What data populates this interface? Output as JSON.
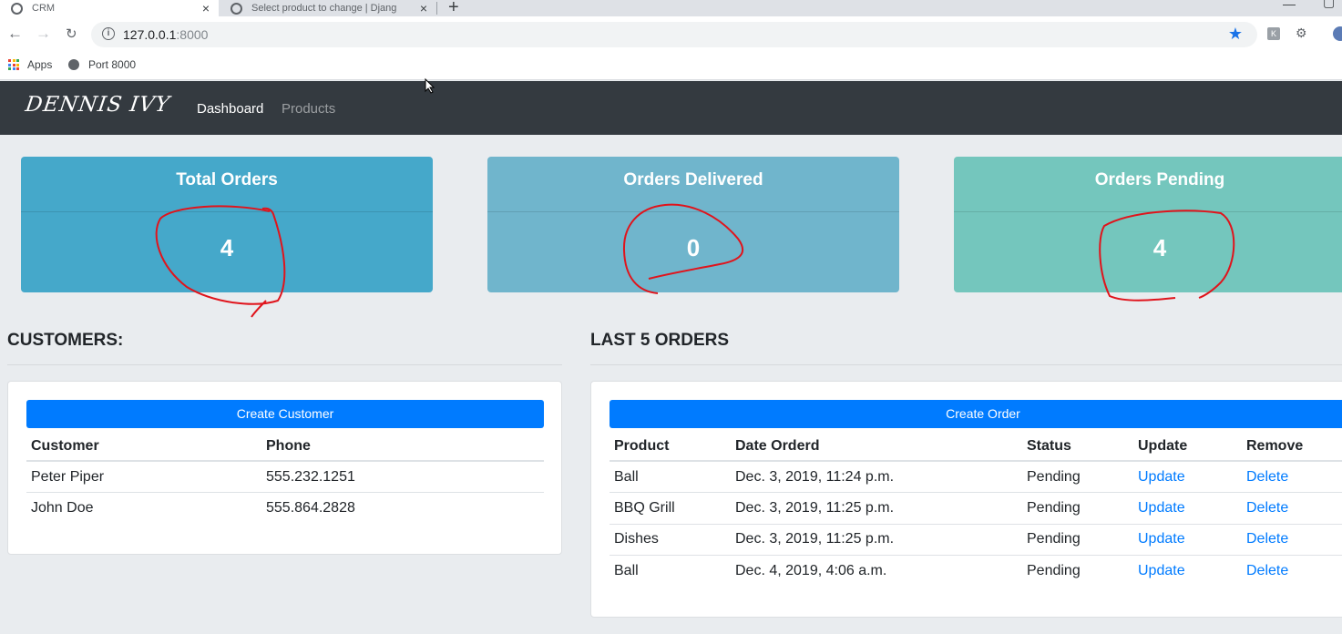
{
  "browser": {
    "tabs": [
      {
        "title": "CRM",
        "active": true
      },
      {
        "title": "Select product to change | Djang",
        "active": false
      }
    ],
    "close_glyph": "×",
    "new_tab_glyph": "+",
    "url_host": "127.0.0.1",
    "url_port": ":8000",
    "bookmarks": [
      "Apps",
      "Port 8000"
    ]
  },
  "navbar": {
    "brand": "DENNIS IVY",
    "links": [
      "Dashboard",
      "Products"
    ]
  },
  "stats": {
    "total": {
      "label": "Total Orders",
      "value": "4"
    },
    "delivered": {
      "label": "Orders Delivered",
      "value": "0"
    },
    "pending": {
      "label": "Orders Pending",
      "value": "4"
    }
  },
  "customers": {
    "title": "CUSTOMERS:",
    "button": "Create Customer",
    "headers": [
      "Customer",
      "Phone"
    ],
    "rows": [
      [
        "Peter Piper",
        "555.232.1251"
      ],
      [
        "John Doe",
        "555.864.2828"
      ]
    ]
  },
  "orders": {
    "title": "LAST 5 ORDERS",
    "button": "Create Order",
    "headers": [
      "Product",
      "Date Orderd",
      "Status",
      "Update",
      "Remove"
    ],
    "rows": [
      [
        "Ball",
        "Dec. 3, 2019, 11:24 p.m.",
        "Pending",
        "Update",
        "Delete"
      ],
      [
        "BBQ Grill",
        "Dec. 3, 2019, 11:25 p.m.",
        "Pending",
        "Update",
        "Delete"
      ],
      [
        "Dishes",
        "Dec. 3, 2019, 11:25 p.m.",
        "Pending",
        "Update",
        "Delete"
      ],
      [
        "Ball",
        "Dec. 4, 2019, 4:06 a.m.",
        "Pending",
        "Update",
        "Delete"
      ]
    ]
  },
  "colors": {
    "navbar": "#343a40",
    "primary": "#007bff",
    "total_card": "#45a8ca",
    "delivered_card": "#70b5cc",
    "pending_card": "#74c6bd",
    "annotation": "#e0141c"
  }
}
